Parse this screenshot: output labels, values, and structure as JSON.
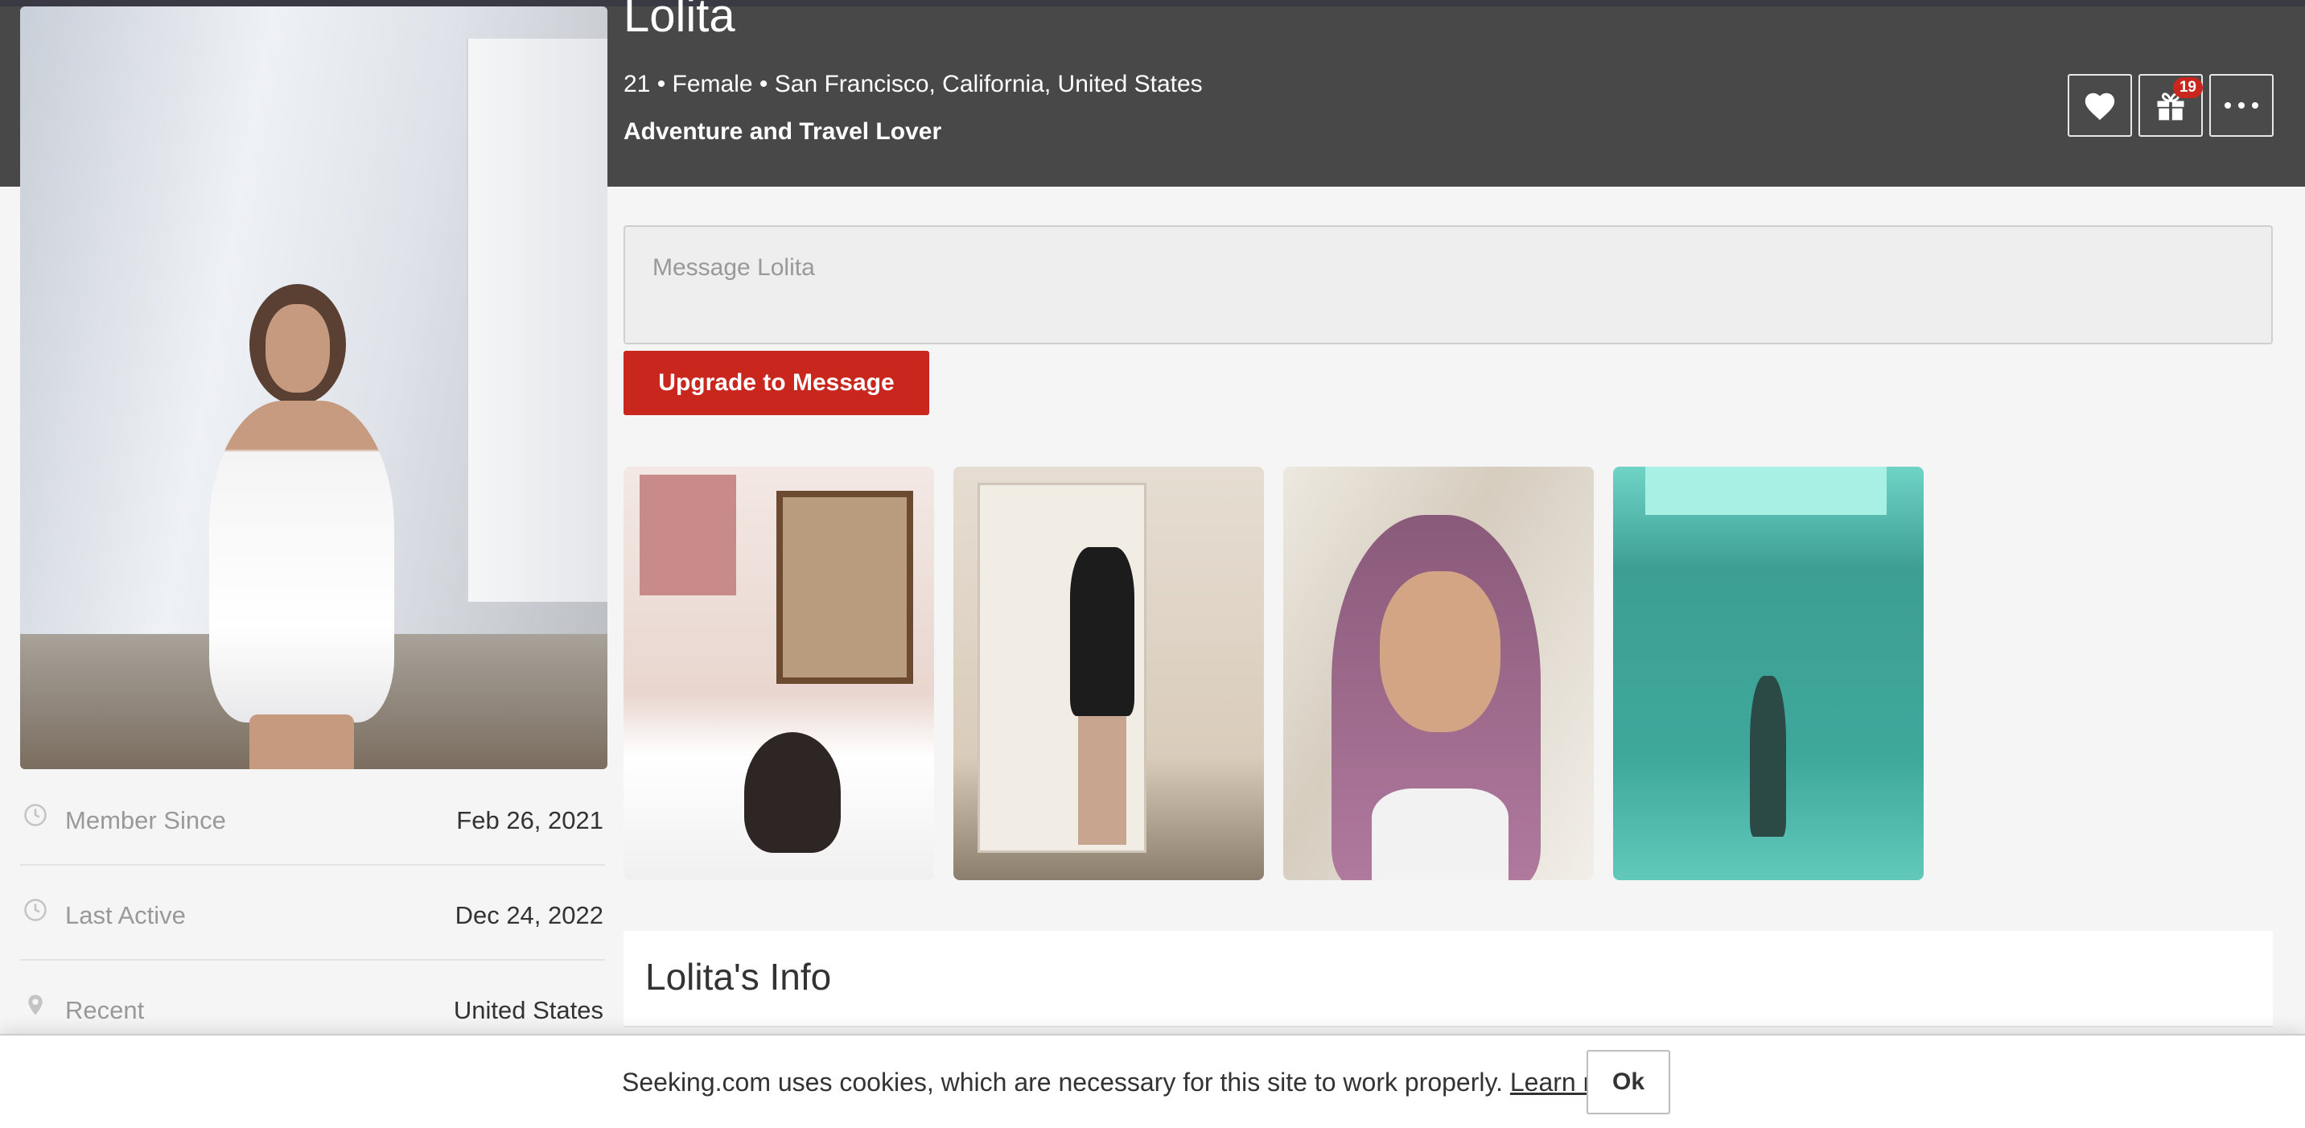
{
  "profile": {
    "name": "Lolita",
    "meta": "21 • Female • San Francisco, California, United States",
    "tagline": "Adventure and Travel Lover"
  },
  "actions": {
    "favorite_icon": "heart-icon",
    "gift_icon": "gift-icon",
    "gift_badge": "19",
    "more_icon": "more-dots-icon"
  },
  "message": {
    "placeholder": "Message Lolita",
    "upgrade_label": "Upgrade to Message"
  },
  "gallery": {
    "photos": [
      "photo-1",
      "photo-2",
      "photo-3",
      "photo-4"
    ]
  },
  "info": {
    "title": "Lolita's Info"
  },
  "stats": [
    {
      "icon": "clock-icon",
      "label": "Member Since",
      "value": "Feb 26, 2021"
    },
    {
      "icon": "clock-icon",
      "label": "Last Active",
      "value": "Dec 24, 2022"
    },
    {
      "icon": "location-pin-icon",
      "label": "Recent",
      "value": "United States"
    }
  ],
  "cookie": {
    "text": "Seeking.com uses cookies, which are necessary for this site to work properly.",
    "link": "Learn more",
    "ok": "Ok"
  },
  "colors": {
    "header_bg": "#484848",
    "accent": "#c9261d",
    "page_bg": "#f5f5f5"
  }
}
